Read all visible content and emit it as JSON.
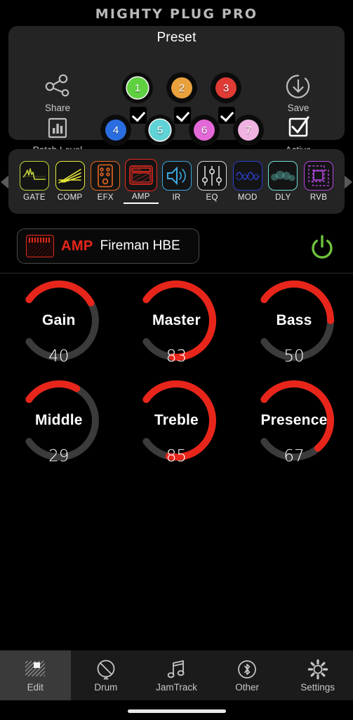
{
  "app": {
    "title": "MIGHTY PLUG PRO"
  },
  "preset_panel": {
    "title": "Preset",
    "tools": {
      "share": {
        "label": "Share",
        "icon": "share-icon"
      },
      "patch_level": {
        "label": "Patch Level",
        "icon": "bar-chart-icon"
      },
      "save": {
        "label": "Save",
        "icon": "save-download-icon"
      },
      "active": {
        "label": "Active",
        "icon": "checkbox-checked-icon"
      }
    },
    "presets": [
      {
        "number": "1",
        "color": "#5fd141",
        "checked": true,
        "selected": true
      },
      {
        "number": "2",
        "color": "#e8a13c",
        "checked": true,
        "selected": false
      },
      {
        "number": "3",
        "color": "#e03b35",
        "checked": true,
        "selected": false
      },
      {
        "number": "4",
        "color": "#2a6de0",
        "checked": true,
        "selected": false
      },
      {
        "number": "5",
        "color": "#5fd3d6",
        "checked": true,
        "selected": true
      },
      {
        "number": "6",
        "color": "#e469d8",
        "checked": true,
        "selected": false
      },
      {
        "number": "7",
        "color": "#f0b2e0",
        "checked": true,
        "selected": false
      }
    ]
  },
  "fx_chain": {
    "prev_arrow": "chevron-left-icon",
    "next_arrow": "chevron-right-icon",
    "slots": [
      {
        "label": "GATE",
        "color": "#c3d13a",
        "active": false
      },
      {
        "label": "COMP",
        "color": "#e8e83a",
        "active": false
      },
      {
        "label": "EFX",
        "color": "#e8681e",
        "active": false
      },
      {
        "label": "AMP",
        "color": "#ee2a20",
        "active": true
      },
      {
        "label": "IR",
        "color": "#3ba6e0",
        "active": false
      },
      {
        "label": "EQ",
        "color": "#d8d8d8",
        "active": false
      },
      {
        "label": "MOD",
        "color": "#2a3fd1",
        "active": false
      },
      {
        "label": "DLY",
        "color": "#6fe0d8",
        "active": false
      },
      {
        "label": "RVB",
        "color": "#b447e0",
        "active": false
      }
    ]
  },
  "amp_row": {
    "kind": "AMP",
    "name": "Fireman HBE",
    "kind_color": "#e8251a",
    "power": {
      "icon": "power-icon",
      "color": "#6ec13e",
      "on": true
    }
  },
  "knobs": [
    {
      "name": "Gain",
      "value": 40,
      "min": 0,
      "max": 100
    },
    {
      "name": "Master",
      "value": 83,
      "min": 0,
      "max": 100
    },
    {
      "name": "Bass",
      "value": 50,
      "min": 0,
      "max": 100
    },
    {
      "name": "Middle",
      "value": 29,
      "min": 0,
      "max": 100
    },
    {
      "name": "Treble",
      "value": 85,
      "min": 0,
      "max": 100
    },
    {
      "name": "Presence",
      "value": 67,
      "min": 0,
      "max": 100
    }
  ],
  "knob_style": {
    "track_color": "#3b3b3b",
    "fill_color": "#e8251a"
  },
  "tabbar": {
    "items": [
      {
        "label": "Edit",
        "icon": "edit-grid-icon",
        "active": true
      },
      {
        "label": "Drum",
        "icon": "drum-nodrum-icon",
        "active": false
      },
      {
        "label": "JamTrack",
        "icon": "music-note-icon",
        "active": false
      },
      {
        "label": "Other",
        "icon": "bluetooth-icon",
        "active": false
      },
      {
        "label": "Settings",
        "icon": "gear-icon",
        "active": false
      }
    ]
  }
}
